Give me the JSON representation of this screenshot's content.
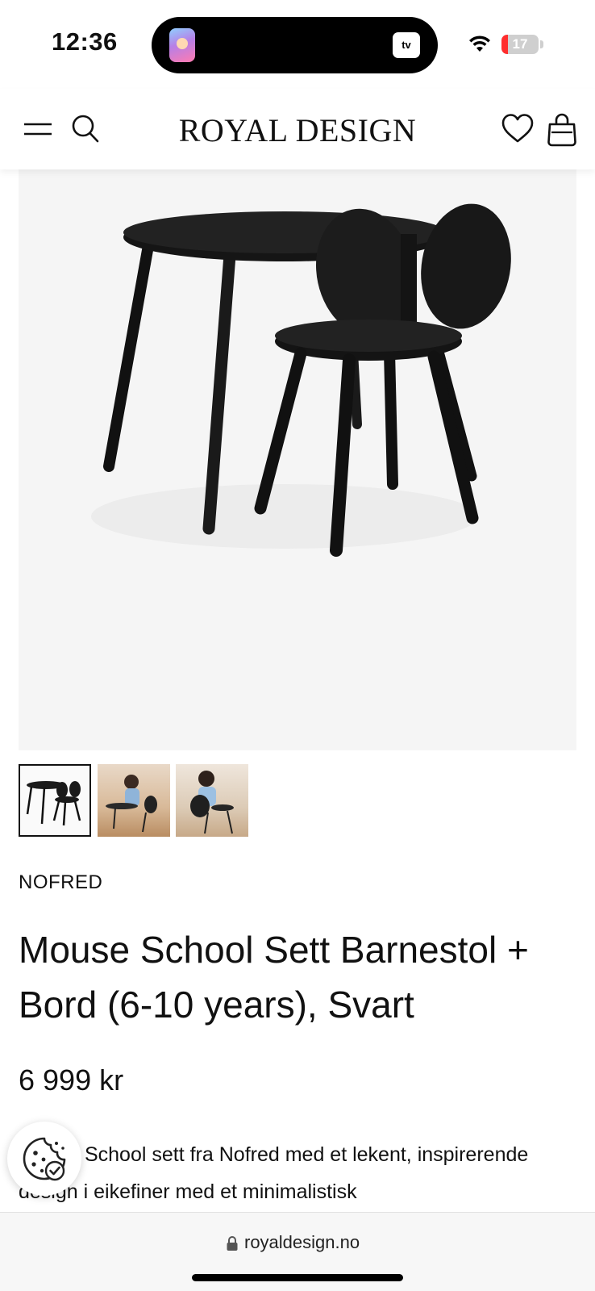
{
  "status_bar": {
    "time": "12:36",
    "live_activity_app": "Apple TV",
    "live_activity_badge": "tv",
    "battery_level": "17",
    "battery_percent": 17,
    "battery_color": "#ff2d2d"
  },
  "header": {
    "logo": "ROYAL DESIGN",
    "icons": [
      "menu-icon",
      "search-icon",
      "heart-icon",
      "bag-icon"
    ]
  },
  "product": {
    "image_alt": "Black children's table and mouse-ear chair",
    "thumbnails": [
      {
        "name": "table-and-chair",
        "selected": true
      },
      {
        "name": "child-at-table-1",
        "selected": false
      },
      {
        "name": "child-at-table-2",
        "selected": false
      }
    ],
    "brand": "NOFRED",
    "title": "Mouse School Sett Barnestol + Bord (6-10 years), Svart",
    "price": "6 999 kr",
    "description": "Mouse School sett fra Nofred med et lekent, inspirerende design i eikefiner med et minimalistisk"
  },
  "cookie_button": {
    "icon": "cookie-icon"
  },
  "browser": {
    "url": "royaldesign.no",
    "lock_icon": "lock-icon"
  },
  "colors": {
    "text": "#111111",
    "image_bg": "#f5f5f5",
    "accent_battery": "#ff2d2d"
  }
}
